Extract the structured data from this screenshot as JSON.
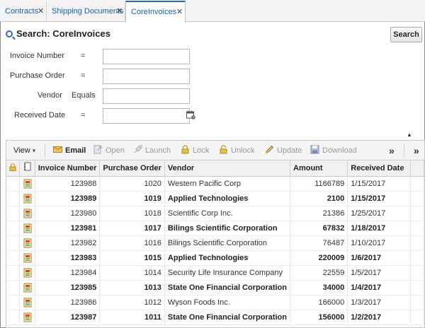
{
  "tabs": [
    {
      "label": "Contracts",
      "close": "✕"
    },
    {
      "label": "Shipping Documents",
      "close": "✕"
    },
    {
      "label": "CoreInvoices",
      "close": "✕",
      "active": true
    }
  ],
  "search": {
    "title": "Search: CoreInvoices",
    "button_label": "Search",
    "fields": [
      {
        "label": "Invoice Number",
        "operator": "=",
        "value": ""
      },
      {
        "label": "Purchase Order",
        "operator": "=",
        "value": ""
      },
      {
        "label": "Vendor",
        "operator": "Equals",
        "value": ""
      },
      {
        "label": "Received Date",
        "operator": "=",
        "value": ""
      }
    ]
  },
  "toolbar": {
    "view_label": "View",
    "view_caret": "▾",
    "overflow": "»",
    "overflow2": "»",
    "actions": [
      {
        "label": "Email",
        "enabled": true,
        "icon": "envelope-icon"
      },
      {
        "label": "Open",
        "enabled": false,
        "icon": "open-icon"
      },
      {
        "label": "Launch",
        "enabled": false,
        "icon": "rocket-icon"
      },
      {
        "label": "Lock",
        "enabled": false,
        "icon": "lock-icon"
      },
      {
        "label": "Unlock",
        "enabled": false,
        "icon": "unlock-icon"
      },
      {
        "label": "Update",
        "enabled": false,
        "icon": "pencil-icon"
      },
      {
        "label": "Download",
        "enabled": false,
        "icon": "floppy-disk-icon"
      }
    ]
  },
  "table": {
    "columns": [
      "Invoice Number",
      "Purchase Order",
      "Vendor",
      "Amount",
      "Received Date"
    ],
    "rows": [
      {
        "invoice": "123988",
        "po": "1020",
        "vendor": "Western Pacific Corp",
        "amount": "1166789",
        "date": "1/15/2017",
        "bold": false
      },
      {
        "invoice": "123989",
        "po": "1019",
        "vendor": "Applied Technologies",
        "amount": "2100",
        "date": "1/15/2017",
        "bold": true
      },
      {
        "invoice": "123980",
        "po": "1018",
        "vendor": "Scientific Corp Inc.",
        "amount": "21386",
        "date": "1/25/2017",
        "bold": false
      },
      {
        "invoice": "123981",
        "po": "1017",
        "vendor": "Bilings Scientific Corporation",
        "amount": "67832",
        "date": "1/18/2017",
        "bold": true
      },
      {
        "invoice": "123982",
        "po": "1016",
        "vendor": "Bilings Scientific Corporation",
        "amount": "76487",
        "date": "1/10/2017",
        "bold": false
      },
      {
        "invoice": "123983",
        "po": "1015",
        "vendor": "Applied Technologies",
        "amount": "220009",
        "date": "1/6/2017",
        "bold": true
      },
      {
        "invoice": "123984",
        "po": "1014",
        "vendor": "Security Life Insurance Company",
        "amount": "22559",
        "date": "1/5/2017",
        "bold": false
      },
      {
        "invoice": "123985",
        "po": "1013",
        "vendor": "State One Financial Corporation",
        "amount": "34000",
        "date": "1/4/2017",
        "bold": true
      },
      {
        "invoice": "123986",
        "po": "1012",
        "vendor": "Wyson Foods Inc.",
        "amount": "166000",
        "date": "1/3/2017",
        "bold": false
      },
      {
        "invoice": "123987",
        "po": "1011",
        "vendor": "State One Financial Corporation",
        "amount": "156000",
        "date": "1/2/2017",
        "bold": true
      }
    ]
  },
  "colors": {
    "accent": "#2b6cb0",
    "tab_text": "#1a5fa6",
    "disabled": "#9a9a9a"
  }
}
